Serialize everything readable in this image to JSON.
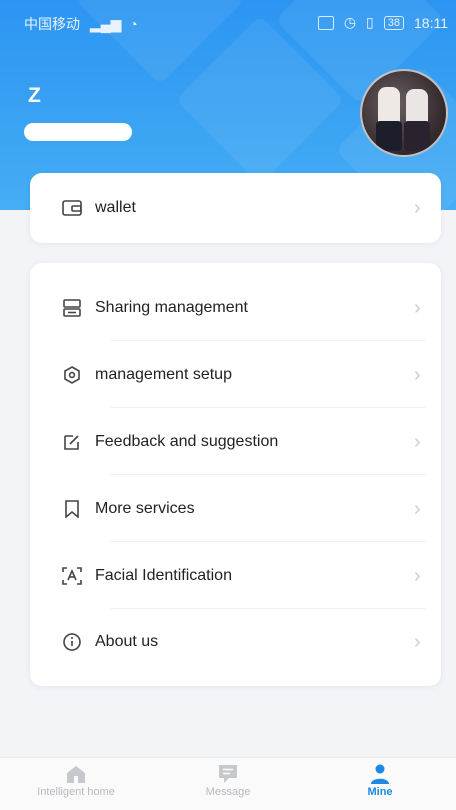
{
  "status_bar": {
    "carrier": "中国移动",
    "battery": "38",
    "time": "18:11"
  },
  "profile": {
    "name": "Z"
  },
  "wallet": {
    "label": "wallet"
  },
  "menu": {
    "items": [
      {
        "label": "Sharing management",
        "icon": "sharing-icon"
      },
      {
        "label": "management setup",
        "icon": "settings-icon"
      },
      {
        "label": "Feedback and suggestion",
        "icon": "edit-icon"
      },
      {
        "label": "More services",
        "icon": "bookmark-icon"
      },
      {
        "label": "Facial Identification",
        "icon": "face-scan-icon"
      },
      {
        "label": "About us",
        "icon": "info-icon"
      }
    ]
  },
  "bottom_nav": {
    "items": [
      {
        "label": "Intelligent home",
        "icon": "home-icon"
      },
      {
        "label": "Message",
        "icon": "message-icon"
      },
      {
        "label": "Mine",
        "icon": "user-icon",
        "active": true
      }
    ]
  },
  "colors": {
    "accent": "#1e88e5",
    "header": "#2c95f2"
  }
}
